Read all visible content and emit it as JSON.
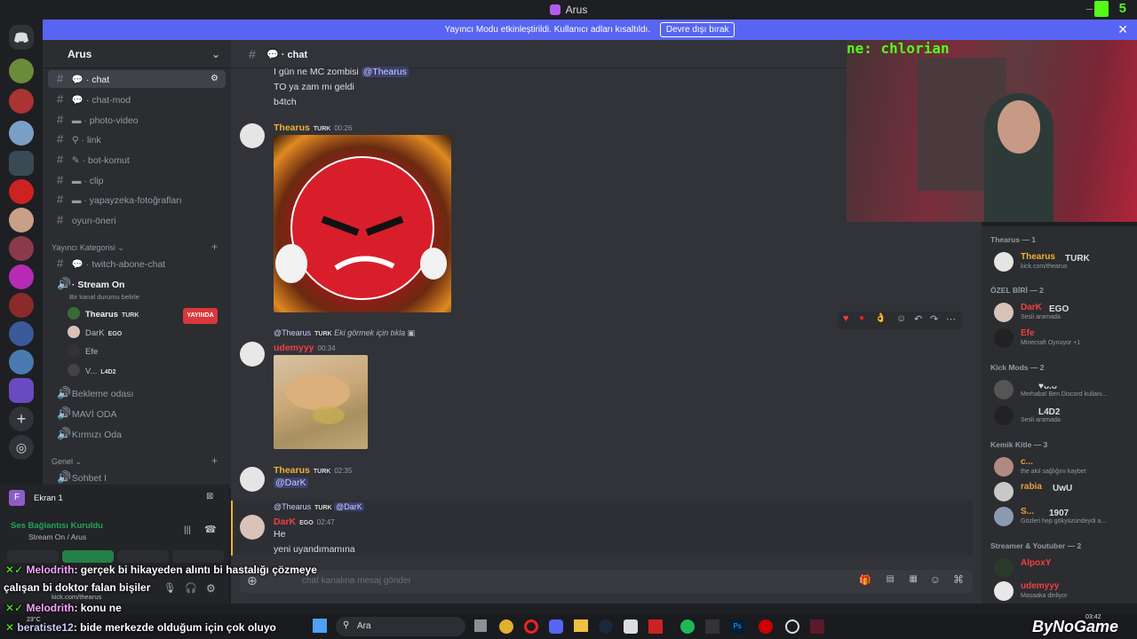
{
  "window": {
    "title": "Arus"
  },
  "banner": {
    "text": "Yayıncı Modu etkinleştirildi. Kullanıcı adları kısaltıldı.",
    "button": "Devre dışı bırak"
  },
  "server": {
    "name": "Arus"
  },
  "channels": [
    {
      "label": "chat",
      "selected": true
    },
    {
      "label": "chat-mod"
    },
    {
      "label": "photo-video"
    },
    {
      "label": "link"
    },
    {
      "label": "bot-komut"
    },
    {
      "label": "clip"
    },
    {
      "label": "yapayzeka-fotoğrafları"
    },
    {
      "label": "oyun-öneri"
    }
  ],
  "category_yayinci": "Yayıncı Kategorisi",
  "channel_twitch": "twitch-abone-chat",
  "voice_stream": {
    "label": "Stream On",
    "status": "Bir kanal durumu belirle"
  },
  "voice_users": [
    {
      "name": "Thearus",
      "tag": "TURK",
      "badge": "YAYINDA"
    },
    {
      "name": "DarK",
      "tag": "EGO"
    },
    {
      "name": "Efe"
    },
    {
      "name": "V...",
      "tag": "L4D2"
    }
  ],
  "voice_channels": [
    "Bekleme odası",
    "MAVİ ODA",
    "Kırmızı Oda"
  ],
  "category_genel": "Genel",
  "channel_sohbet": "Sohbet I",
  "panel": {
    "screen": "Ekran 1",
    "voice_status": "Ses Bağlantısı Kuruldu",
    "voice_channel": "Stream On / Arus",
    "user_status": "kick.com/thearus"
  },
  "chat": {
    "channel": "chat",
    "lines_top": [
      "I gün ne MC zombisi",
      "@Thearus",
      "TO ya zam mı geldi",
      "b4tch"
    ],
    "msg1": {
      "author": "Thearus",
      "tag": "TURK",
      "time": "00:26"
    },
    "msg2": {
      "reply_to": "@Thearus",
      "reply_tag": "TURK",
      "reply_text": "Eki görmek için tıkla",
      "author": "udemyyy",
      "time": "00:34"
    },
    "msg3": {
      "author": "Thearus",
      "tag": "TURK",
      "time": "02:35",
      "text": "@DarK"
    },
    "msg4": {
      "reply_to": "@Thearus",
      "reply_tag": "TURK",
      "reply_text": "@DarK",
      "author": "DarK",
      "tag": "EGO",
      "time": "02:47",
      "text1": "He",
      "text2": "yeni uyandımamına"
    },
    "input_placeholder": "chat kanalına mesaj gönder"
  },
  "webcam": {
    "title_text": "ne: chlorian"
  },
  "members": {
    "groups": [
      {
        "title": "Thearus — 1",
        "items": [
          {
            "name": "Thearus",
            "tag": "TURK",
            "status": "kick.com/thearus",
            "color": "#f0b232"
          }
        ]
      },
      {
        "title": "ÖZEL BİRİ — 2",
        "items": [
          {
            "name": "DarK",
            "tag": "EGO",
            "status": "Sesli aramada",
            "color": "#f23f43"
          },
          {
            "name": "Efe",
            "tag": "",
            "status": "Minecraft Oynuyor +1",
            "color": "#f23f43"
          }
        ]
      },
      {
        "title": "Kick Mods — 2",
        "items": [
          {
            "name": "",
            "tag": "♥ᴗ.ᴗ",
            "status": "Merhaba! Ben Discord kullanı...",
            "color": "#5865f2"
          },
          {
            "name": "",
            "tag": "L4D2",
            "status": "Sesli aramada",
            "color": "#5865f2"
          }
        ]
      },
      {
        "title": "Kemik Kitle — 3",
        "items": [
          {
            "name": "c...",
            "tag": "",
            "status": "the akıl sağlığını kaybet",
            "color": "#e8a33d"
          },
          {
            "name": "rabia",
            "tag": "UwU",
            "status": "",
            "color": "#e8a33d"
          },
          {
            "name": "S...",
            "tag": "1907",
            "status": "Gözleri hep gökyüzündeydi a...",
            "color": "#e8a33d"
          }
        ]
      },
      {
        "title": "Streamer & Youtuber — 2",
        "items": [
          {
            "name": "AlpoxY",
            "tag": "",
            "status": "",
            "color": "#f23f43"
          },
          {
            "name": "udemyyy",
            "tag": "",
            "status": "Masaaka dinliyor",
            "color": "#f23f43"
          }
        ]
      }
    ]
  },
  "overlay_chat": [
    {
      "user": "Melodrith",
      "text": ": gerçek bi hikayeden alıntı bi hastalığı çözmeye"
    },
    {
      "user": "",
      "text": "çalışan bi doktor falan bişiler"
    },
    {
      "user": "Melodrith",
      "text": ": konu ne"
    },
    {
      "user": "beratiste12",
      "text": ": bide merkezde olduğum için çok oluyo"
    }
  ],
  "taskbar": {
    "search": "Ara",
    "weather": "23°C",
    "time": "03:42",
    "brand": "ByNoGame"
  },
  "kick_count": "5"
}
